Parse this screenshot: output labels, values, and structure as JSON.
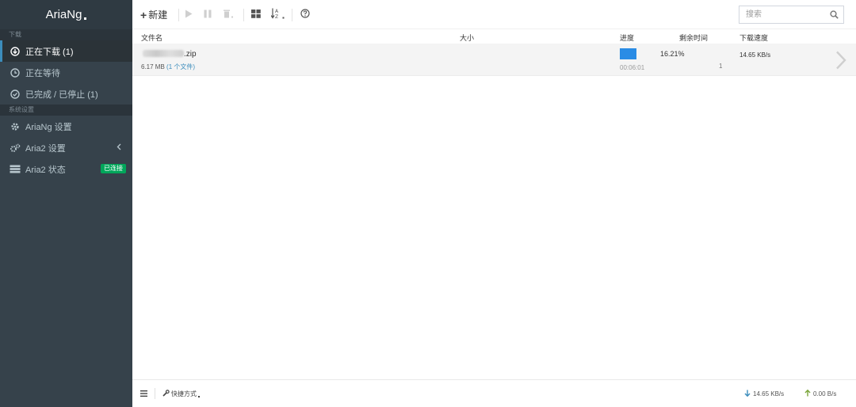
{
  "sidebar": {
    "brand": "AriaNg",
    "sections": [
      {
        "title": "下载"
      },
      {
        "title": "系统设置"
      }
    ],
    "download_items": [
      {
        "label": "正在下载 (1)",
        "icon": "download-circle-icon",
        "active": true
      },
      {
        "label": "正在等待",
        "icon": "clock-icon"
      },
      {
        "label": "已完成 / 已停止 (1)",
        "icon": "check-circle-icon"
      }
    ],
    "settings_items": [
      {
        "label": "AriaNg 设置",
        "icon": "gear-icon"
      },
      {
        "label": "Aria2 设置",
        "icon": "gears-icon"
      },
      {
        "label": "Aria2 状态",
        "icon": "server-icon",
        "badge": "已连接"
      }
    ]
  },
  "toolbar": {
    "new_label": "新建",
    "search_placeholder": "搜索"
  },
  "table": {
    "headers": {
      "name": "文件名",
      "size": "大小",
      "progress": "进度",
      "remaining": "剩余时间",
      "speed": "下载速度"
    },
    "rows": [
      {
        "name_suffix": ".zip",
        "size": "6.17 MB",
        "files": "(1 个文件)",
        "progress_fraction": 0.1621,
        "elapsed": "00:06:01",
        "percent": "16.21%",
        "connections": "1",
        "speed": "14.65 KB/s"
      }
    ]
  },
  "footer": {
    "shortcut_label": "快捷方式",
    "download_speed": "14.65 KB/s",
    "upload_speed": "0.00 B/s"
  },
  "colors": {
    "sidebar_bg": "#36424b",
    "accent": "#3c8dbc",
    "progress": "#2a8ce5",
    "badge": "#00a65a"
  }
}
